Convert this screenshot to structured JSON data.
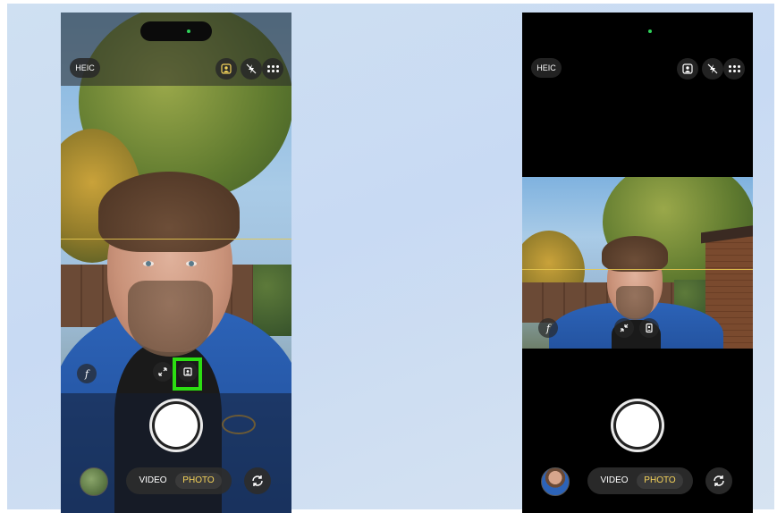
{
  "left_phone": {
    "format_label": "HEIC",
    "modes": {
      "video": "VIDEO",
      "photo": "PHOTO"
    },
    "active_mode": "PHOTO",
    "aperture_symbol": "f",
    "highlighted_control": "portrait-orientation-toggle"
  },
  "right_phone": {
    "format_label": "HEIC",
    "modes": {
      "video": "VIDEO",
      "photo": "PHOTO"
    },
    "active_mode": "PHOTO",
    "aperture_symbol": "f"
  },
  "colors": {
    "highlight": "#2cde12",
    "active_mode_text": "#f5d35a",
    "camera_indicator": "#2fd15a"
  },
  "icons": [
    "portrait-mode-icon",
    "flash-off-icon",
    "more-options-icon",
    "expand-arrows-icon",
    "rotate-frame-icon",
    "flip-camera-icon"
  ]
}
